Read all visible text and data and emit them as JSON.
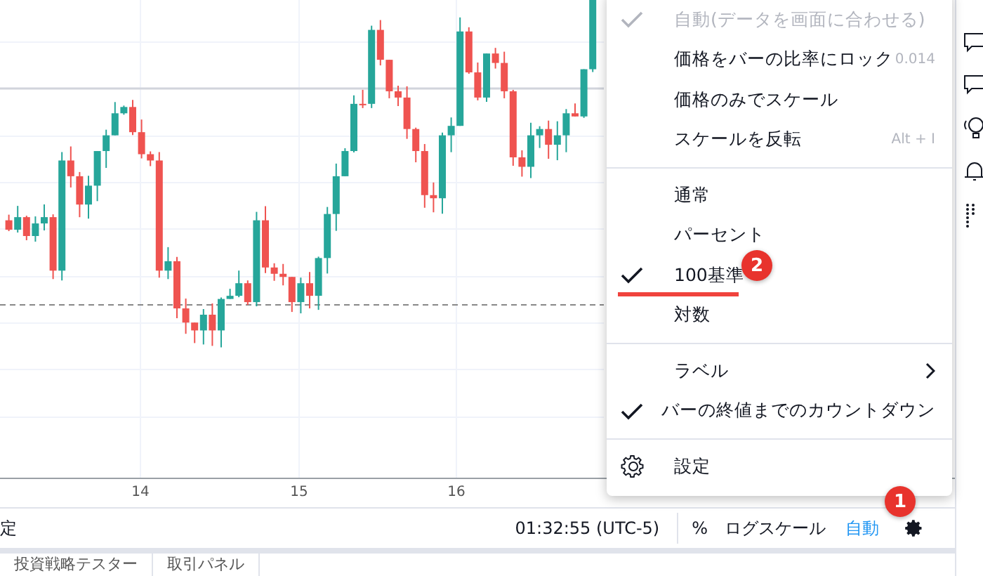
{
  "chart": {
    "x_labels": [
      "14",
      "15",
      "16"
    ]
  },
  "scale_menu": {
    "items": [
      {
        "kind": "item",
        "label": "自動(データを画面に合わせる)",
        "checked": true,
        "disabled": true
      },
      {
        "kind": "item",
        "label": "価格をバーの比率にロック",
        "checked": false,
        "disabled": false,
        "shortcut": "0.014"
      },
      {
        "kind": "item",
        "label": "価格のみでスケール",
        "checked": false,
        "disabled": false
      },
      {
        "kind": "item",
        "label": "スケールを反転",
        "checked": false,
        "disabled": false,
        "shortcut": "Alt + I"
      },
      {
        "kind": "separator"
      },
      {
        "kind": "item",
        "label": "通常",
        "checked": false,
        "disabled": false
      },
      {
        "kind": "item",
        "label": "パーセント",
        "checked": false,
        "disabled": false
      },
      {
        "kind": "item",
        "label": "100基準",
        "checked": true,
        "disabled": false,
        "underlined": true,
        "badge": "2"
      },
      {
        "kind": "item",
        "label": "対数",
        "checked": false,
        "disabled": false
      },
      {
        "kind": "separator"
      },
      {
        "kind": "submenu",
        "label": "ラベル",
        "checked": false,
        "disabled": false
      },
      {
        "kind": "item",
        "label": "バーの終値までのカウントダウン",
        "checked": true,
        "disabled": false
      },
      {
        "kind": "separator"
      },
      {
        "kind": "settings",
        "label": "設定"
      }
    ]
  },
  "status_bar": {
    "left_text": "定",
    "time": "01:32:55 (UTC-5)",
    "percent": "%",
    "log_scale": "ログスケール",
    "auto": {
      "label": "自動",
      "on": true
    },
    "settings_badge": "1"
  },
  "bottom_tabs": [
    "投資戦略テスター",
    "取引パネル"
  ]
}
